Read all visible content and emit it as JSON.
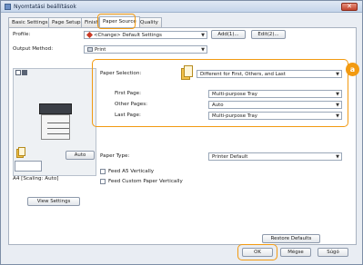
{
  "window": {
    "title": "Nyomtatási beállítások",
    "close_glyph": "✕"
  },
  "tabs": [
    {
      "label": "Basic Settings"
    },
    {
      "label": "Page Setup"
    },
    {
      "label": "Finishing"
    },
    {
      "label": "Paper Source"
    },
    {
      "label": "Quality"
    }
  ],
  "profile": {
    "label": "Profile:",
    "value": "<Change> Default Settings",
    "add_button": "Add(1)...",
    "edit_button": "Edit(2)..."
  },
  "output_method": {
    "label": "Output Method:",
    "value": "Print"
  },
  "preview": {
    "auto_button": "Auto",
    "scaling_text": "A4 [Scaling: Auto]",
    "view_settings_button": "View Settings"
  },
  "paper_selection": {
    "label": "Paper Selection:",
    "value": "Different for First, Others, and Last",
    "badge": "a",
    "first_page_label": "First Page:",
    "first_page_value": "Multi-purpose Tray",
    "other_pages_label": "Other Pages:",
    "other_pages_value": "Auto",
    "last_page_label": "Last Page:",
    "last_page_value": "Multi-purpose Tray"
  },
  "paper_type": {
    "label": "Paper Type:",
    "value": "Printer Default"
  },
  "checkboxes": {
    "feed_a5": "Feed A5 Vertically",
    "feed_custom": "Feed Custom Paper Vertically"
  },
  "restore_defaults_button": "Restore Defaults",
  "footer": {
    "ok": "OK",
    "cancel": "Mégse",
    "help": "Súgó"
  },
  "colors": {
    "highlight": "#f29a11"
  }
}
